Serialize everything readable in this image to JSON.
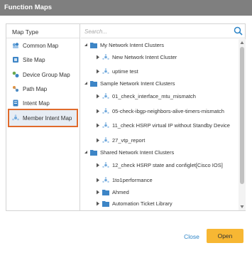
{
  "dialog": {
    "title": "Function Maps"
  },
  "map_type": {
    "heading": "Map Type",
    "items": [
      {
        "label": "Common Map",
        "icon": "common-map-icon"
      },
      {
        "label": "Site Map",
        "icon": "site-map-icon"
      },
      {
        "label": "Device Group Map",
        "icon": "device-group-map-icon"
      },
      {
        "label": "Path Map",
        "icon": "path-map-icon"
      },
      {
        "label": "Intent Map",
        "icon": "intent-map-icon"
      },
      {
        "label": "Member Intent Map",
        "icon": "member-intent-map-icon",
        "selected": true
      }
    ]
  },
  "search": {
    "placeholder": "Search...",
    "value": ""
  },
  "tree": [
    {
      "label": "My Network Intent Clusters",
      "kind": "folder",
      "expanded": true
    },
    {
      "label": "New Network Intent Cluster",
      "kind": "cluster"
    },
    {
      "label": "uptime test",
      "kind": "cluster"
    },
    {
      "label": "Sample Network Intent Clusters",
      "kind": "folder",
      "expanded": true
    },
    {
      "label": "01_check_interface_mtu_mismatch",
      "kind": "cluster"
    },
    {
      "label": "05-check-ibgp-neighbors-alive-timers-mismatch",
      "kind": "cluster"
    },
    {
      "label": "11_check HSRP virtual IP without Standby Device",
      "kind": "cluster"
    },
    {
      "label": "27_vtp_report",
      "kind": "cluster"
    },
    {
      "label": "Shared Network Intent Clusters",
      "kind": "folder",
      "expanded": true
    },
    {
      "label": "12_check HSRP state and configlet[Cisco IOS]",
      "kind": "cluster"
    },
    {
      "label": "1to1performance",
      "kind": "cluster"
    },
    {
      "label": "Ahmed",
      "kind": "folder",
      "expanded": false
    },
    {
      "label": "Automation Ticket Library",
      "kind": "folder",
      "expanded": false
    }
  ],
  "footer": {
    "close_label": "Close",
    "open_label": "Open"
  },
  "colors": {
    "accent": "#f7b733",
    "link": "#2f86c8",
    "selection_border": "#e06b2c",
    "titlebar": "#7f7f7f"
  }
}
